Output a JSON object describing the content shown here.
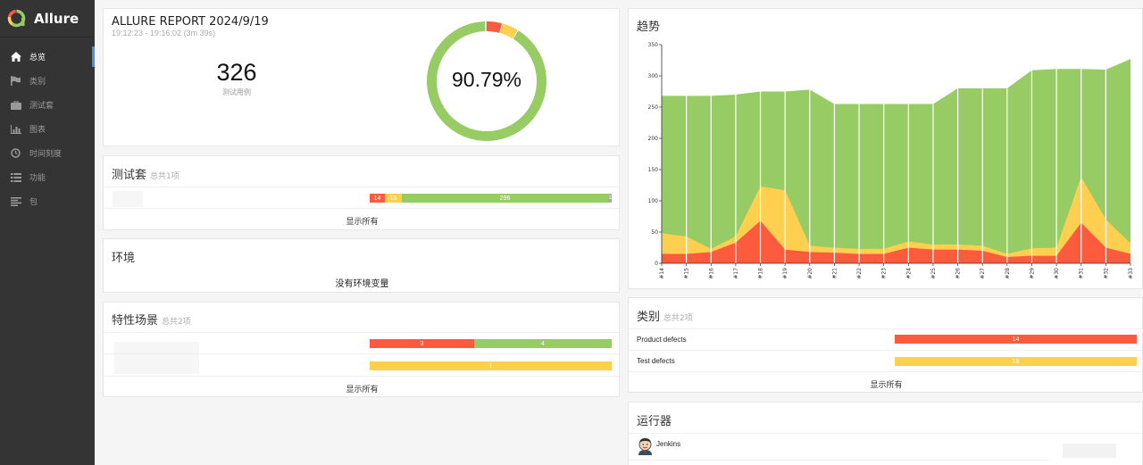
{
  "brand": {
    "name": "Allure"
  },
  "nav": [
    {
      "label": "总览",
      "icon": "home-icon",
      "active": true
    },
    {
      "label": "类别",
      "icon": "flag-icon",
      "active": false
    },
    {
      "label": "测试套",
      "icon": "briefcase-icon",
      "active": false
    },
    {
      "label": "图表",
      "icon": "bar-chart-icon",
      "active": false
    },
    {
      "label": "时间刻度",
      "icon": "clock-icon",
      "active": false
    },
    {
      "label": "功能",
      "icon": "list-icon",
      "active": false
    },
    {
      "label": "包",
      "icon": "align-left-icon",
      "active": false
    }
  ],
  "summary": {
    "title": "ALLURE REPORT 2024/9/19",
    "time": "19:12:23 - 19:16:02 (3m 39s)",
    "total": "326",
    "total_label": "测试用例",
    "success_rate": "90.79%",
    "donut": {
      "failed": 14,
      "broken": 15,
      "passed": 296,
      "skipped": 1
    }
  },
  "suites": {
    "title": "测试套",
    "count": "总共1项",
    "bar": {
      "failed": "14",
      "broken": "15",
      "passed": "296",
      "skipped": "1"
    },
    "show_all": "显示所有"
  },
  "environment": {
    "title": "环境",
    "empty": "没有环境变量"
  },
  "features": {
    "title": "特性场景",
    "count": "总共2项",
    "rows": [
      {
        "failed": "3",
        "passed": "4"
      },
      {
        "broken": "1"
      }
    ],
    "show_all": "显示所有"
  },
  "trend": {
    "title": "趋势"
  },
  "categories": {
    "title": "类别",
    "count": "总共2项",
    "items": [
      {
        "label": "Product defects",
        "value": "14",
        "color": "#fd5a3e"
      },
      {
        "label": "Test defects",
        "value": "15",
        "color": "#ffd050"
      }
    ],
    "show_all": "显示所有"
  },
  "executors": {
    "title": "运行器",
    "name": "Jenkins"
  },
  "colors": {
    "failed": "#fd5a3e",
    "broken": "#ffd050",
    "passed": "#97cc64",
    "skipped": "#aaaaaa",
    "accent": "#4a90d9"
  },
  "chart_data": {
    "type": "area",
    "title": "趋势",
    "x": [
      "#14",
      "#15",
      "#16",
      "#17",
      "#18",
      "#19",
      "#20",
      "#21",
      "#22",
      "#23",
      "#24",
      "#25",
      "#26",
      "#27",
      "#28",
      "#29",
      "#30",
      "#31",
      "#32",
      "#33"
    ],
    "ylim": [
      0,
      350
    ],
    "yticks": [
      0,
      50,
      100,
      150,
      200,
      250,
      300,
      350
    ],
    "series": [
      {
        "name": "failed",
        "values": [
          15,
          15,
          18,
          33,
          68,
          22,
          18,
          17,
          15,
          15,
          25,
          22,
          22,
          20,
          10,
          12,
          12,
          65,
          25,
          15
        ]
      },
      {
        "name": "broken",
        "values": [
          33,
          28,
          5,
          10,
          55,
          95,
          10,
          8,
          8,
          8,
          10,
          8,
          8,
          8,
          5,
          12,
          13,
          73,
          45,
          17
        ]
      },
      {
        "name": "passed",
        "values": [
          220,
          225,
          245,
          227,
          152,
          158,
          250,
          230,
          232,
          232,
          220,
          225,
          250,
          252,
          265,
          285,
          286,
          173,
          240,
          295
        ]
      }
    ],
    "grid": false
  }
}
